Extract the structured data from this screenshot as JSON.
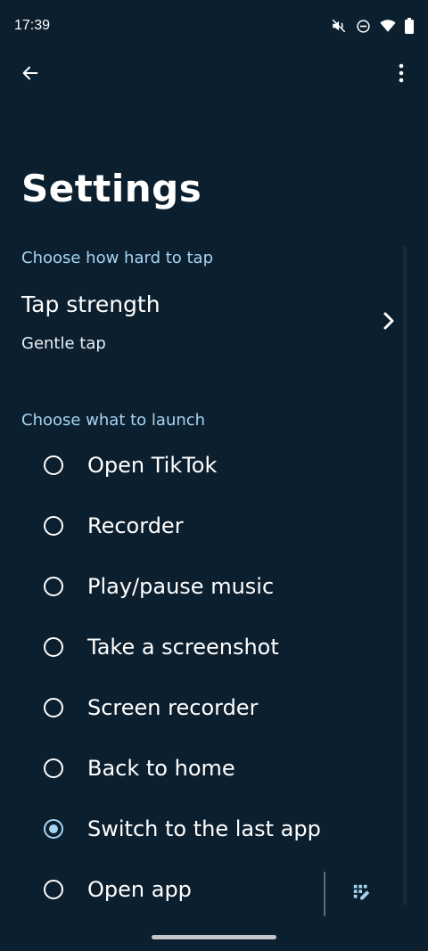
{
  "status_bar": {
    "time": "17:39",
    "icons": [
      "mute-vibrate-off-icon",
      "do-not-disturb-icon",
      "wifi-icon",
      "battery-icon"
    ]
  },
  "top_bar": {
    "back_icon": "arrow-left-icon",
    "more_icon": "more-vert-icon"
  },
  "page": {
    "title": "Settings"
  },
  "tap_section": {
    "header": "Choose how hard to tap",
    "row_title": "Tap strength",
    "row_value": "Gentle tap",
    "chevron_icon": "chevron-right-icon"
  },
  "launch_section": {
    "header": "Choose what to launch",
    "options": [
      {
        "label": "Open TikTok",
        "selected": false
      },
      {
        "label": "Recorder",
        "selected": false
      },
      {
        "label": "Play/pause music",
        "selected": false
      },
      {
        "label": "Take a screenshot",
        "selected": false
      },
      {
        "label": "Screen recorder",
        "selected": false
      },
      {
        "label": "Back to home",
        "selected": false
      },
      {
        "label": "Switch to the last app",
        "selected": true
      },
      {
        "label": "Open app",
        "selected": false
      }
    ],
    "app_picker_icon": "app-grid-edit-icon"
  },
  "colors": {
    "background": "#0c1f2e",
    "accent": "#a6d4f2",
    "text": "#ffffff"
  }
}
